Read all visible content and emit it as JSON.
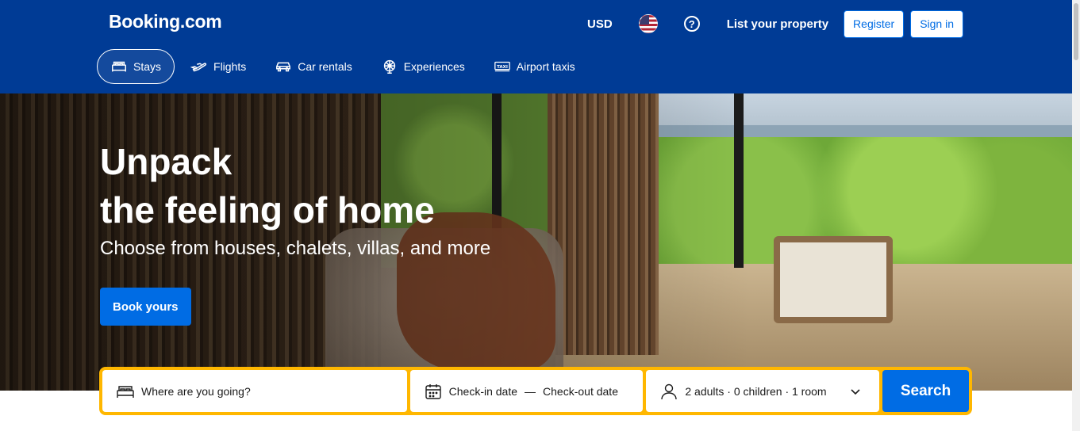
{
  "header": {
    "logo": "Booking.com",
    "currency": "USD",
    "flag_icon": "us-flag-icon",
    "help_icon": "question-mark-icon",
    "help_glyph": "?",
    "list_property": "List your property",
    "register": "Register",
    "sign_in": "Sign in",
    "bg_color": "#003b95"
  },
  "nav": {
    "items": [
      {
        "label": "Stays",
        "icon": "bed-icon",
        "active": true
      },
      {
        "label": "Flights",
        "icon": "plane-icon",
        "active": false
      },
      {
        "label": "Car rentals",
        "icon": "car-icon",
        "active": false
      },
      {
        "label": "Experiences",
        "icon": "attractions-icon",
        "active": false
      },
      {
        "label": "Airport taxis",
        "icon": "taxi-icon",
        "active": false
      }
    ]
  },
  "hero": {
    "title_line1": "Unpack",
    "title_line2": "the feeling of home",
    "subtitle": "Choose from houses, chalets, villas, and more",
    "cta": "Book yours",
    "cta_color": "#006ce4"
  },
  "search": {
    "destination_placeholder": "Where are you going?",
    "checkin": "Check-in date",
    "date_separator": "—",
    "checkout": "Check-out date",
    "occupancy": "2 adults · 0 children · 1 room",
    "button": "Search",
    "border_color": "#ffb700"
  }
}
